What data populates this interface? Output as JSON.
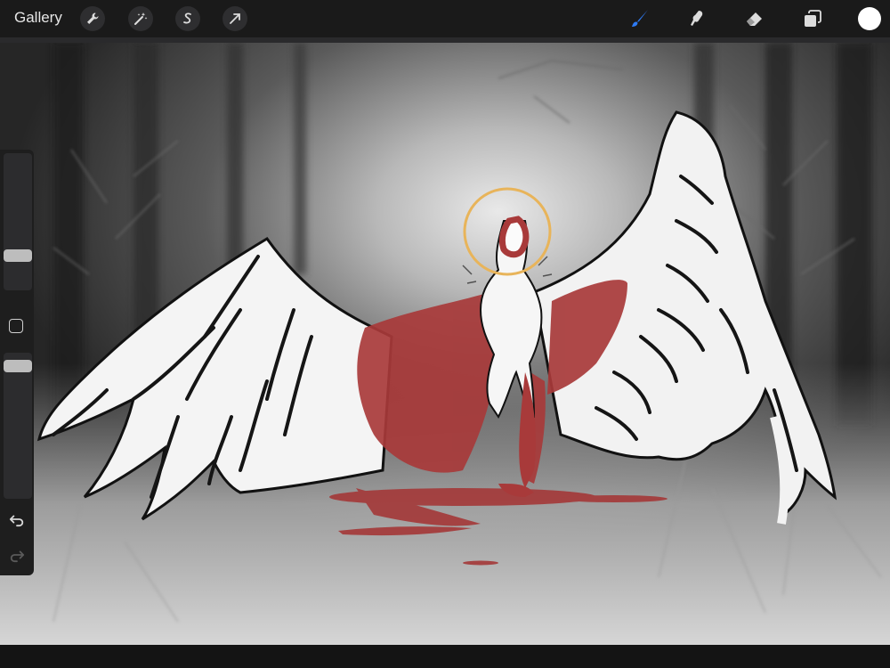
{
  "toolbar": {
    "gallery_label": "Gallery",
    "left_tools": [
      "actions-icon",
      "adjustments-icon",
      "selection-icon",
      "transform-icon"
    ],
    "right_tools": [
      "brush-icon",
      "smudge-icon",
      "eraser-icon",
      "layers-icon"
    ],
    "active_tool": "brush-icon",
    "accent_color": "#2e7bf6",
    "current_color": "#ffffff"
  },
  "sidebar": {
    "brush_size_level": 0.18,
    "opacity_level": 0.95,
    "controls": [
      "brush-size-slider",
      "modify-button",
      "opacity-slider",
      "undo-button",
      "redo-button"
    ],
    "redo_enabled": false
  },
  "canvas": {
    "artwork_colors": {
      "blood": "#a83a3a",
      "halo": "#e8b45a",
      "wing": "#f2f2f2",
      "ink": "#111111"
    }
  }
}
